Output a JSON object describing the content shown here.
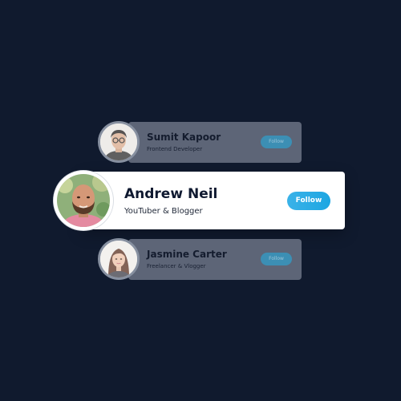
{
  "theme": {
    "background": "#101a2e",
    "accent": "#1da6e2"
  },
  "profiles": [
    {
      "name": "Sumit Kapoor",
      "role": "Frontend Developer",
      "follow_label": "Follow",
      "avatar_icon": "man-with-glasses-avatar"
    },
    {
      "name": "Andrew Neil",
      "role": "YouTuber & Blogger",
      "follow_label": "Follow",
      "avatar_icon": "bald-man-beard-avatar"
    },
    {
      "name": "Jasmine Carter",
      "role": "Freelancer & Vlogger",
      "follow_label": "Follow",
      "avatar_icon": "woman-avatar"
    }
  ]
}
